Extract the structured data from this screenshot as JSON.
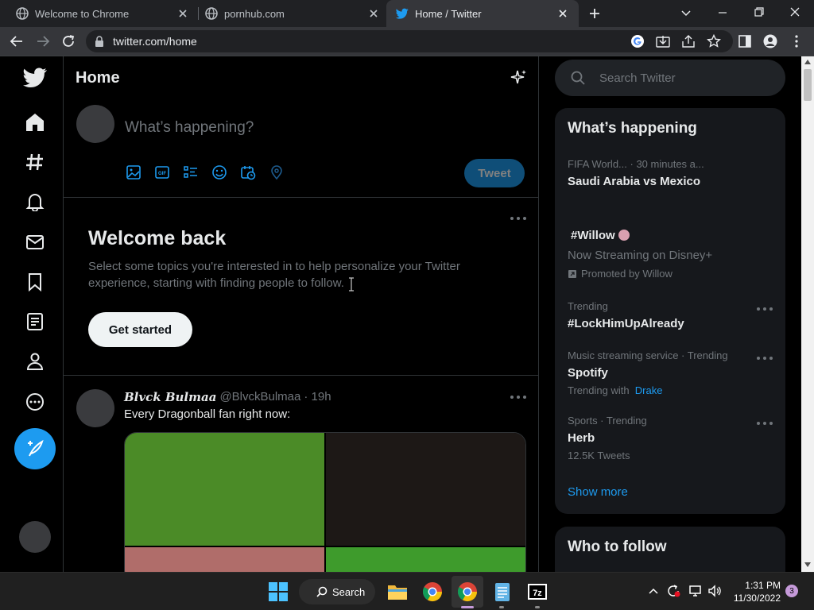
{
  "browser": {
    "tabs": [
      {
        "title": "Welcome to Chrome",
        "active": false
      },
      {
        "title": "pornhub.com",
        "active": false
      },
      {
        "title": "Home / Twitter",
        "active": true
      }
    ],
    "url": "twitter.com/home"
  },
  "twitter": {
    "header_title": "Home",
    "compose": {
      "placeholder": "What’s happening?",
      "tweet_button": "Tweet"
    },
    "welcome": {
      "title": "Welcome back",
      "body": "Select some topics you're interested in to help personalize your Twitter experience, starting with finding people to follow.",
      "button": "Get started"
    },
    "tweet": {
      "display_name": "𝑩𝒍𝒗𝒄𝒌 𝑩𝒖𝒍𝒎𝒂𝒂",
      "handle": "@BlvckBulmaa",
      "time": "· 19h",
      "text": "Every Dragonball fan right now:"
    },
    "search_placeholder": "Search Twitter",
    "whats_happening": {
      "title": "What’s happening",
      "items": [
        {
          "meta": "FIFA World...",
          "time": "· 30 minutes a...",
          "title": "Saudi Arabia vs Mexico"
        },
        {
          "title": "#Willow",
          "subtitle": "Now Streaming on Disney+",
          "promoted": "Promoted by Willow"
        },
        {
          "meta": "Trending",
          "title": "#LockHimUpAlready"
        },
        {
          "meta": "Music streaming service · Trending",
          "title": "Spotify",
          "extra_prefix": "Trending with",
          "extra_link": "Drake"
        },
        {
          "meta": "Sports · Trending",
          "title": "Herb",
          "extra": "12.5K Tweets"
        }
      ],
      "show_more": "Show more"
    },
    "who_to_follow": "Who to follow"
  },
  "taskbar": {
    "search_label": "Search",
    "time": "1:31 PM",
    "date": "11/30/2022",
    "notification_count": "3"
  },
  "colors": {
    "twitter_blue": "#1d9bf0",
    "tweet_button_disabled": "#0f4e78"
  }
}
